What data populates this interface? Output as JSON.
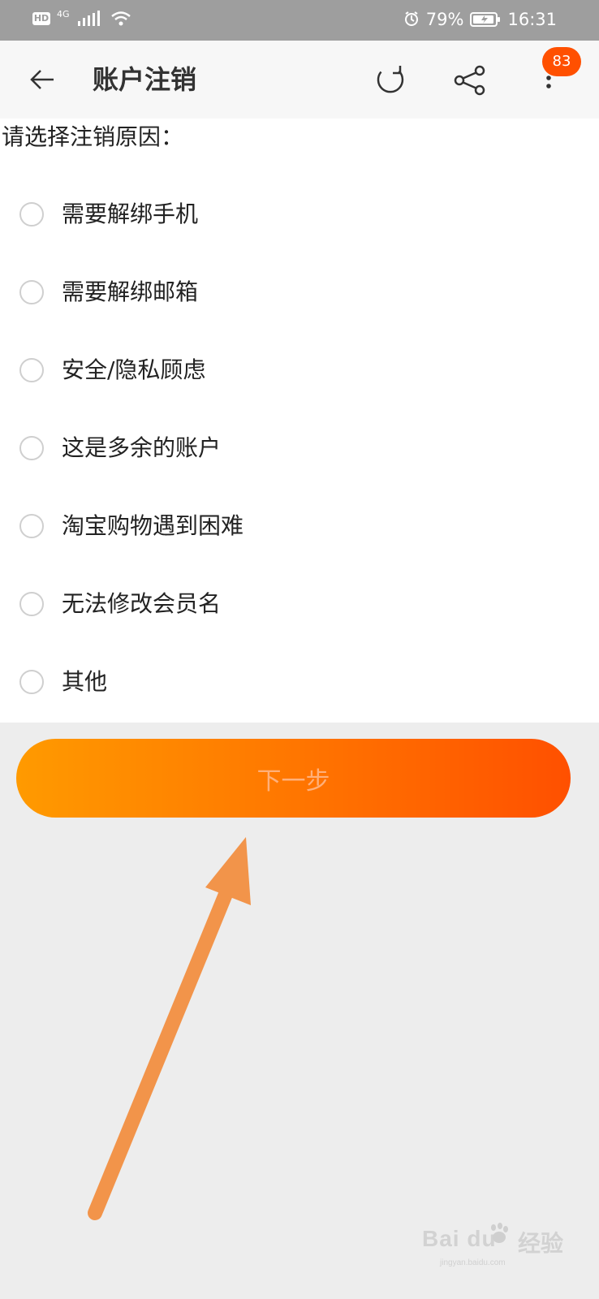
{
  "status_bar": {
    "network_badge": "HD",
    "network_type": "4G",
    "battery_percent": "79%",
    "time": "16:31",
    "icons": [
      "hd-icon",
      "signal-icon",
      "wifi-icon",
      "alarm-icon",
      "battery-icon"
    ]
  },
  "header": {
    "title": "账户注销",
    "notification_count": "83",
    "icons": [
      "back-arrow-icon",
      "refresh-icon",
      "share-icon",
      "more-vertical-icon"
    ]
  },
  "content": {
    "prompt": "请选择注销原因：",
    "options": [
      {
        "label": "需要解绑手机",
        "selected": false
      },
      {
        "label": "需要解绑邮箱",
        "selected": false
      },
      {
        "label": "安全/隐私顾虑",
        "selected": false
      },
      {
        "label": "这是多余的账户",
        "selected": false
      },
      {
        "label": "淘宝购物遇到困难",
        "selected": false
      },
      {
        "label": "无法修改会员名",
        "selected": false
      },
      {
        "label": "其他",
        "selected": false
      }
    ]
  },
  "footer": {
    "next_label": "下一步"
  },
  "annotation": {
    "arrow_color": "#f2944a"
  },
  "watermark": {
    "brand": "Bai du",
    "suffix": "经验",
    "subtext": "jingyan.baidu.com"
  },
  "colors": {
    "accent": "#ff5000",
    "button_start": "#ff9a00",
    "button_end": "#ff5000"
  }
}
